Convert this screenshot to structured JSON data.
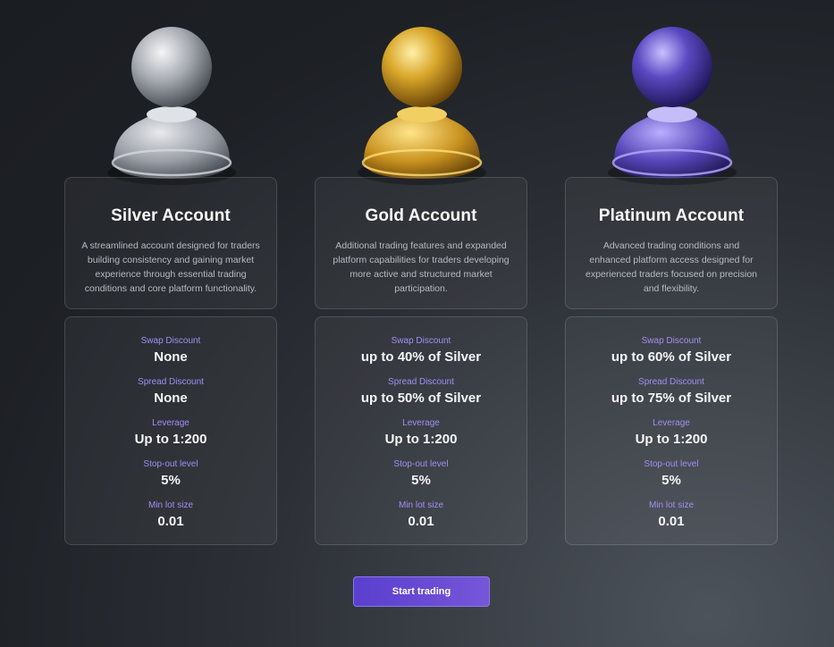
{
  "accounts": [
    {
      "title": "Silver Account",
      "description": "A streamlined account designed for traders building consistency and gaining market experience through essential trading conditions and core platform functionality.",
      "icon": "silver-pawn-icon",
      "color": "#c9ccd2",
      "stats": [
        {
          "label": "Swap Discount",
          "value": "None"
        },
        {
          "label": "Spread Discount",
          "value": "None"
        },
        {
          "label": "Leverage",
          "value": "Up to 1:200"
        },
        {
          "label": "Stop-out level",
          "value": "5%"
        },
        {
          "label": "Min lot size",
          "value": "0.01"
        }
      ]
    },
    {
      "title": "Gold Account",
      "description": "Additional trading features and expanded platform capabilities for traders developing more active and structured market participation.",
      "icon": "gold-pawn-icon",
      "color": "#d9a62a",
      "stats": [
        {
          "label": "Swap Discount",
          "value": "up to 40% of Silver"
        },
        {
          "label": "Spread Discount",
          "value": "up to 50% of Silver"
        },
        {
          "label": "Leverage",
          "value": "Up to 1:200"
        },
        {
          "label": "Stop-out level",
          "value": "5%"
        },
        {
          "label": "Min lot size",
          "value": "0.01"
        }
      ]
    },
    {
      "title": "Platinum Account",
      "description": "Advanced trading conditions and enhanced platform access designed for experienced traders focused on precision and flexibility.",
      "icon": "platinum-pawn-icon",
      "color": "#6656c8",
      "stats": [
        {
          "label": "Swap Discount",
          "value": "up to 60% of Silver"
        },
        {
          "label": "Spread Discount",
          "value": "up to 75% of Silver"
        },
        {
          "label": "Leverage",
          "value": "Up to 1:200"
        },
        {
          "label": "Stop-out level",
          "value": "5%"
        },
        {
          "label": "Min lot size",
          "value": "0.01"
        }
      ]
    }
  ],
  "cta": {
    "label": "Start trading"
  },
  "colors": {
    "accent": "#6a4fd6",
    "label": "#a28ef2"
  }
}
